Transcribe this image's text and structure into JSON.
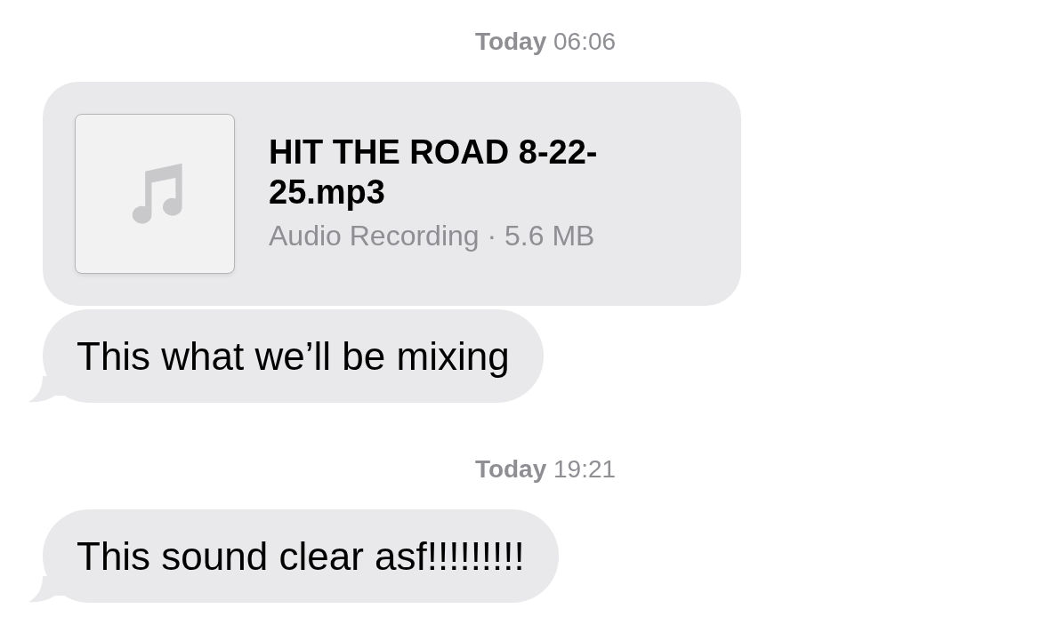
{
  "messages": [
    {
      "kind": "timestamp",
      "day": "Today",
      "time": "06:06"
    },
    {
      "kind": "file",
      "title": "HIT THE ROAD 8-22-25.mp3",
      "subtitle": "Audio Recording · 5.6 MB",
      "tail": false
    },
    {
      "kind": "text",
      "text": "This what we’ll be mixing",
      "tail": true
    },
    {
      "kind": "timestamp",
      "day": "Today",
      "time": "19:21"
    },
    {
      "kind": "text",
      "text": "This sound clear asf!!!!!!!!!",
      "tail": true
    }
  ]
}
